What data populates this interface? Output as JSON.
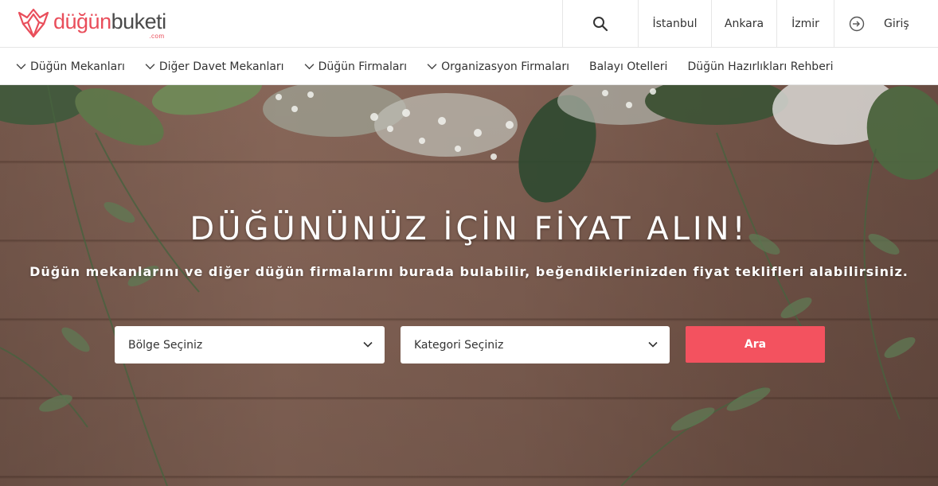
{
  "brand": {
    "logo_part1": "düğün",
    "logo_part2": "buketi",
    "logo_suffix": ".com",
    "accent_color": "#e94e5b"
  },
  "header": {
    "search_icon": "search-icon",
    "cities": [
      "İstanbul",
      "Ankara",
      "İzmir"
    ],
    "login_label": "Giriş",
    "login_icon": "login-icon"
  },
  "nav": {
    "items": [
      {
        "label": "Düğün Mekanları",
        "has_dropdown": true
      },
      {
        "label": "Diğer Davet Mekanları",
        "has_dropdown": true
      },
      {
        "label": "Düğün Firmaları",
        "has_dropdown": true
      },
      {
        "label": "Organizasyon Firmaları",
        "has_dropdown": true
      },
      {
        "label": "Balayı Otelleri",
        "has_dropdown": false
      },
      {
        "label": "Düğün Hazırlıkları Rehberi",
        "has_dropdown": false
      }
    ]
  },
  "hero": {
    "title": "DÜĞÜNÜNÜZ İÇİN FİYAT ALIN!",
    "subtitle": "Düğün mekanlarını ve diğer düğün firmalarını burada bulabilir, beğendiklerinizden fiyat teklifleri alabilirsiniz.",
    "region_placeholder": "Bölge Seçiniz",
    "category_placeholder": "Kategori Seçiniz",
    "search_button": "Ara",
    "button_color": "#f3525f"
  }
}
